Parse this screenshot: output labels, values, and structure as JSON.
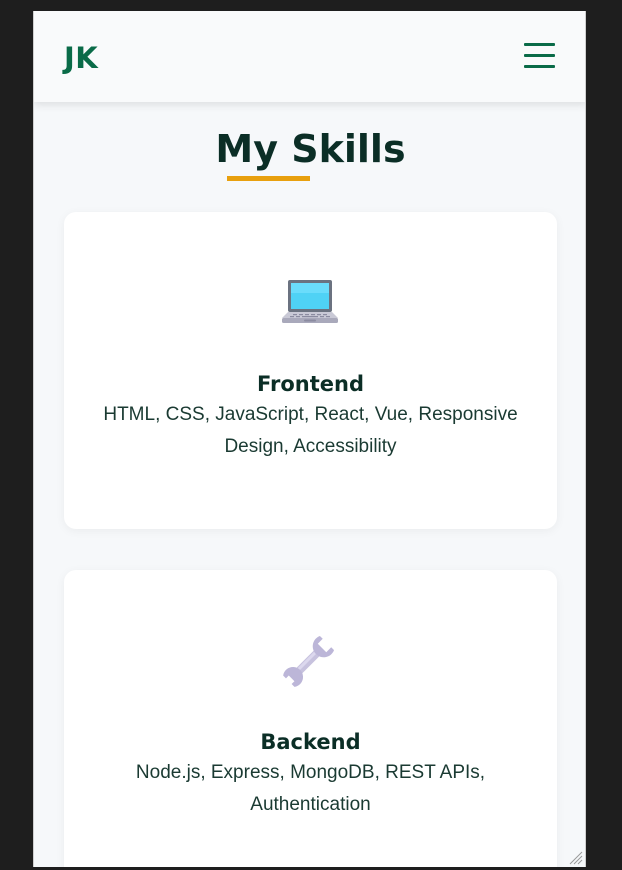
{
  "header": {
    "logo": "JK",
    "menu_icon": "hamburger-menu-icon"
  },
  "skills": {
    "title": "My Skills",
    "accent_color": "#e8a00e",
    "cards": [
      {
        "icon": "laptop-icon",
        "heading": "Frontend",
        "text": "HTML, CSS, JavaScript, React, Vue, Responsive Design, Accessibility"
      },
      {
        "icon": "wrench-icon",
        "heading": "Backend",
        "text": "Node.js, Express, MongoDB, REST APIs, Authentication"
      }
    ]
  },
  "colors": {
    "brand": "#0a6b48",
    "heading": "#0b2e26",
    "page_bg": "#f6f8fa"
  }
}
